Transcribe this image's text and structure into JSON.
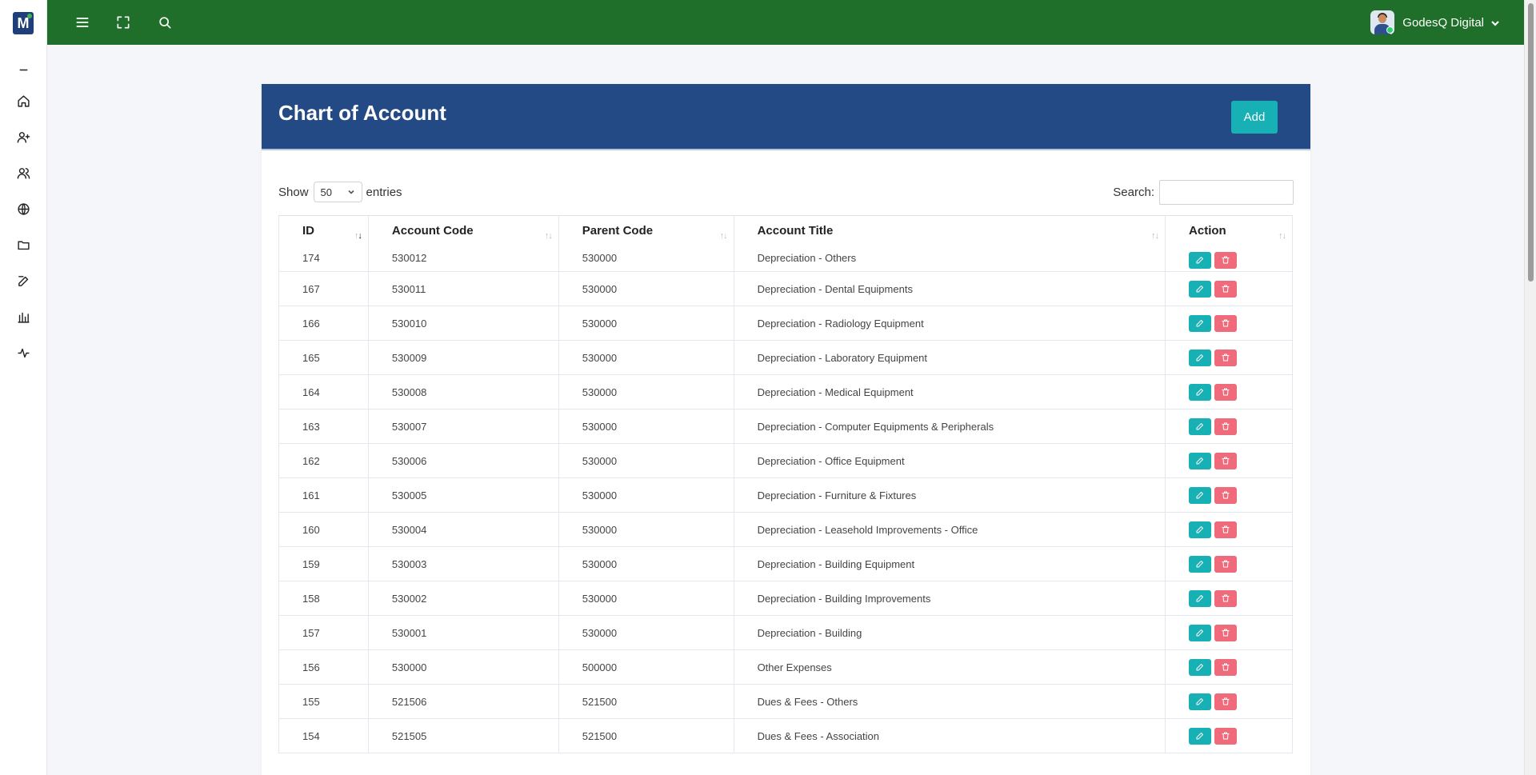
{
  "user": {
    "name": "GodesQ Digital"
  },
  "page": {
    "title": "Chart of Account",
    "add_label": "Add"
  },
  "length": {
    "prefix": "Show",
    "value": "50",
    "suffix": "entries"
  },
  "search": {
    "label": "Search:",
    "value": ""
  },
  "table": {
    "columns": [
      "ID",
      "Account Code",
      "Parent Code",
      "Account Title",
      "Action"
    ],
    "rows": [
      {
        "id": "174",
        "code": "530012",
        "parent": "530000",
        "title": "Depreciation - Others"
      },
      {
        "id": "167",
        "code": "530011",
        "parent": "530000",
        "title": "Depreciation - Dental Equipments"
      },
      {
        "id": "166",
        "code": "530010",
        "parent": "530000",
        "title": "Depreciation - Radiology Equipment"
      },
      {
        "id": "165",
        "code": "530009",
        "parent": "530000",
        "title": "Depreciation - Laboratory Equipment"
      },
      {
        "id": "164",
        "code": "530008",
        "parent": "530000",
        "title": "Depreciation - Medical Equipment"
      },
      {
        "id": "163",
        "code": "530007",
        "parent": "530000",
        "title": "Depreciation - Computer Equipments & Peripherals"
      },
      {
        "id": "162",
        "code": "530006",
        "parent": "530000",
        "title": "Depreciation - Office Equipment"
      },
      {
        "id": "161",
        "code": "530005",
        "parent": "530000",
        "title": "Depreciation - Furniture & Fixtures"
      },
      {
        "id": "160",
        "code": "530004",
        "parent": "530000",
        "title": "Depreciation - Leasehold Improvements - Office"
      },
      {
        "id": "159",
        "code": "530003",
        "parent": "530000",
        "title": "Depreciation - Building Equipment"
      },
      {
        "id": "158",
        "code": "530002",
        "parent": "530000",
        "title": "Depreciation - Building Improvements"
      },
      {
        "id": "157",
        "code": "530001",
        "parent": "530000",
        "title": "Depreciation - Building"
      },
      {
        "id": "156",
        "code": "530000",
        "parent": "500000",
        "title": "Other Expenses"
      },
      {
        "id": "155",
        "code": "521506",
        "parent": "521500",
        "title": "Dues & Fees - Others"
      },
      {
        "id": "154",
        "code": "521505",
        "parent": "521500",
        "title": "Dues & Fees - Association"
      }
    ]
  },
  "colors": {
    "topbar": "#1f6f2a",
    "header": "#234a85",
    "accent": "#17b0b5",
    "danger": "#ef6b7c"
  },
  "icons": {
    "sidebar": [
      "collapse-icon",
      "home-icon",
      "user-plus-icon",
      "users-icon",
      "globe-icon",
      "folder-icon",
      "edit-icon",
      "bar-chart-icon",
      "activity-icon"
    ],
    "topbar": [
      "menu-icon",
      "fullscreen-icon",
      "search-icon"
    ],
    "actions": [
      "edit-icon",
      "trash-icon"
    ]
  }
}
